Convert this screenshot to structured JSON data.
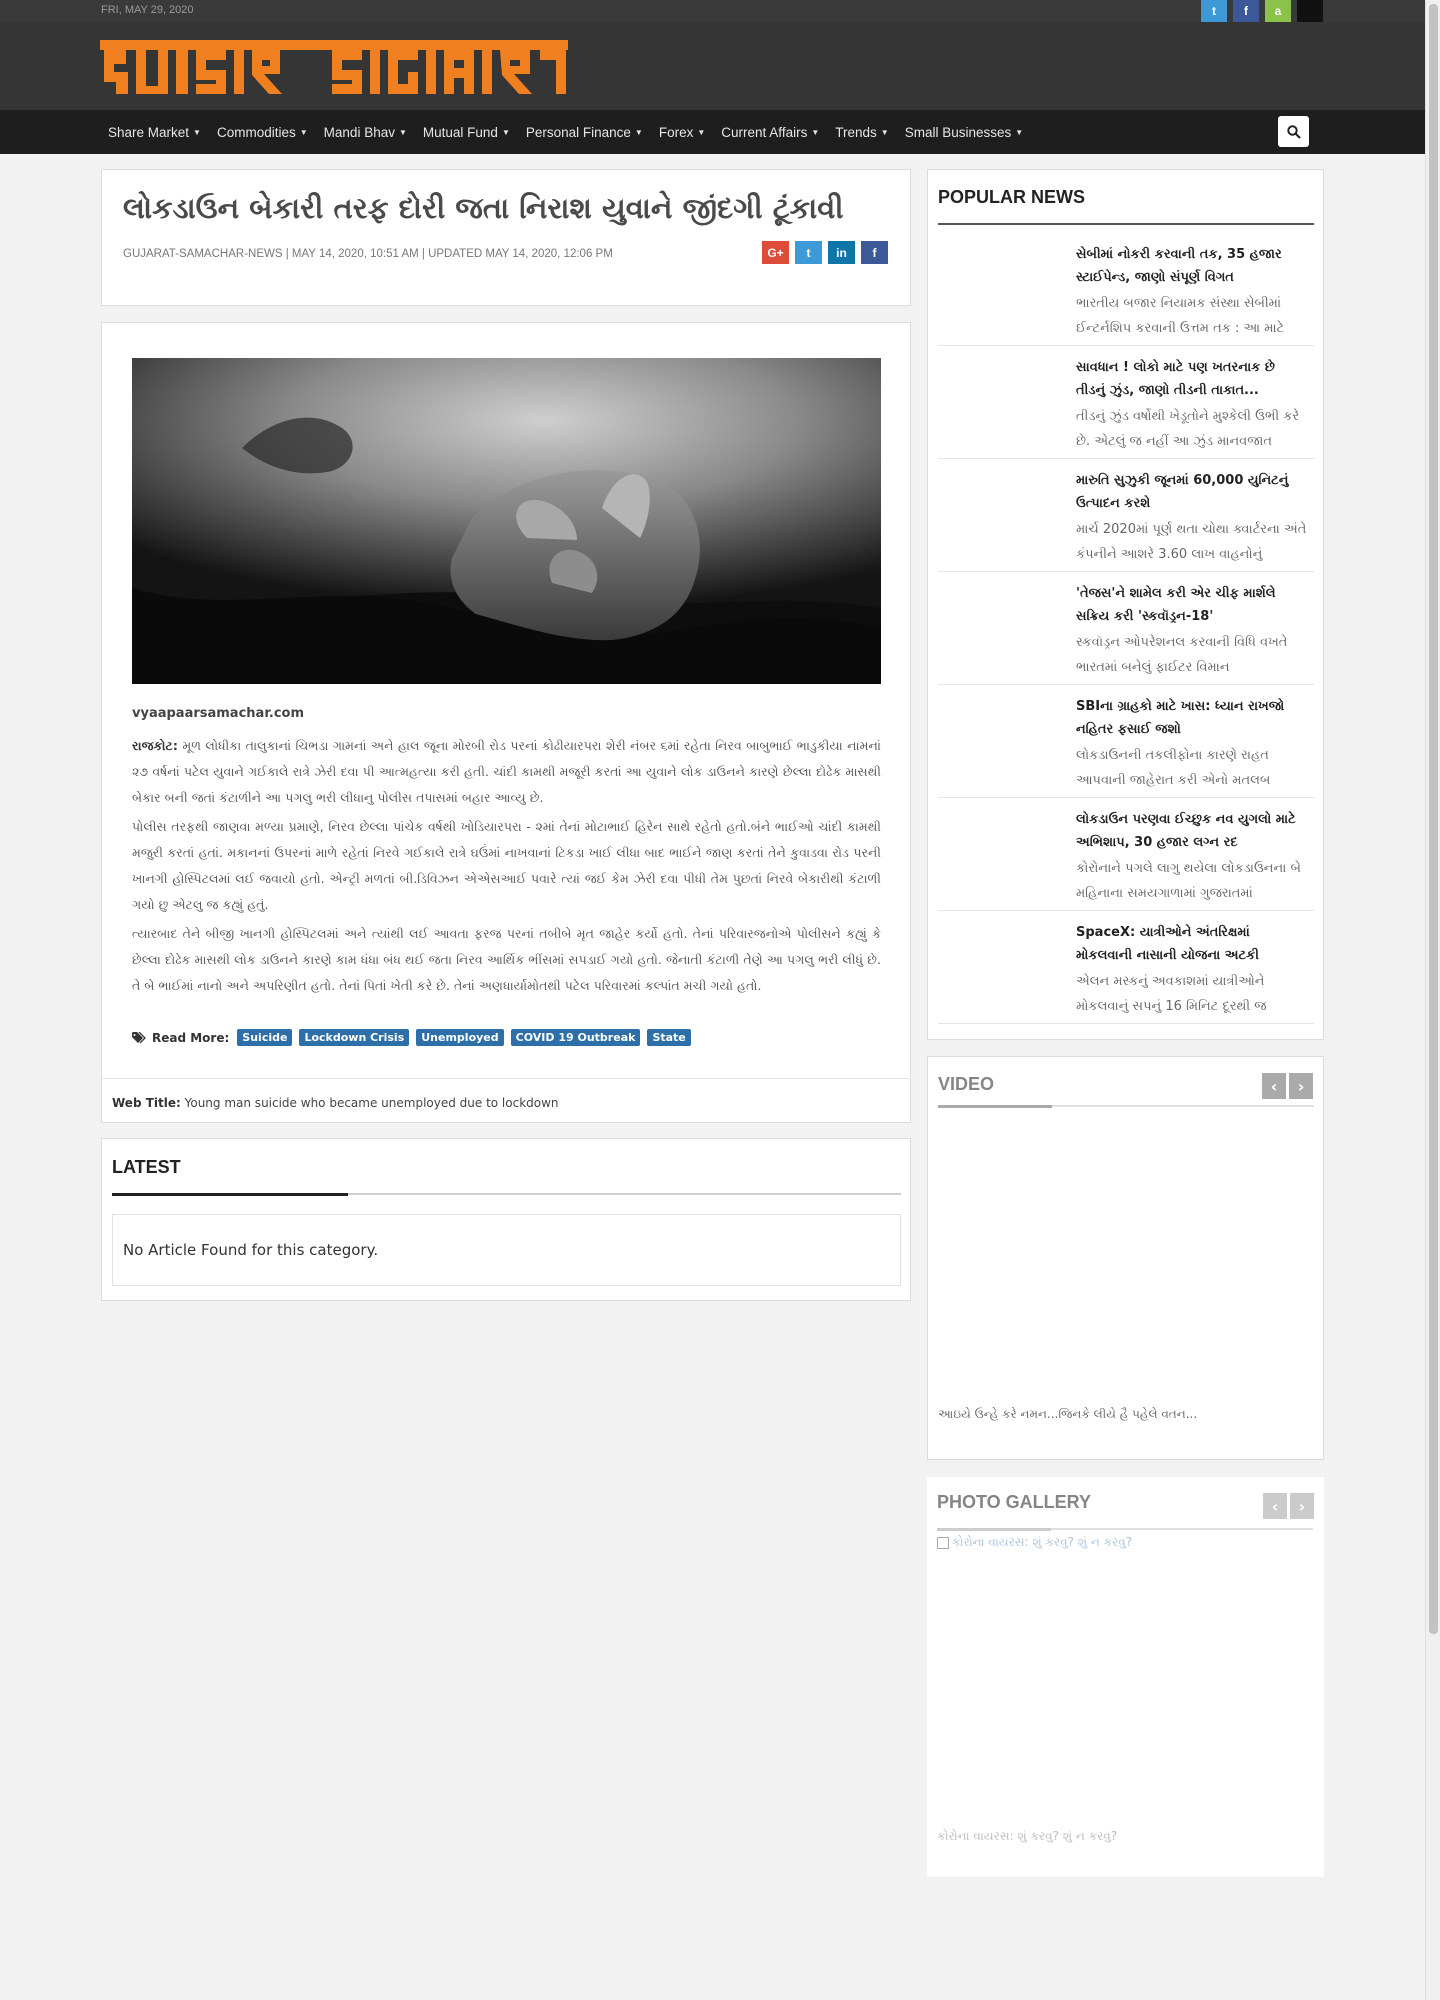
{
  "topbar": {
    "date": "FRI, MAY 29, 2020"
  },
  "social_top": [
    {
      "icon": "twitter-icon",
      "glyph": "t",
      "color": "#3d9ad6"
    },
    {
      "icon": "facebook-icon",
      "glyph": "f",
      "color": "#3b5998"
    },
    {
      "icon": "android-icon",
      "glyph": "a",
      "color": "#8bc34a"
    },
    {
      "icon": "apple-icon",
      "glyph": "",
      "color": "#111111"
    }
  ],
  "logo": {
    "text": "વ્યાપાર સમાચાર",
    "color": "#f07f20"
  },
  "nav": [
    {
      "label": "Share Market"
    },
    {
      "label": "Commodities"
    },
    {
      "label": "Mandi Bhav"
    },
    {
      "label": "Mutual Fund"
    },
    {
      "label": "Personal Finance"
    },
    {
      "label": "Forex"
    },
    {
      "label": "Current Affairs"
    },
    {
      "label": "Trends"
    },
    {
      "label": "Small Businesses"
    }
  ],
  "article": {
    "headline": "લોકડાઉન બેકારી તરફ દોરી જતા નિરાશ યુવાને જીંદગી ટૂંકાવી",
    "meta": "GUJARAT-SAMACHAR-NEWS | MAY 14, 2020, 10:51 AM | UPDATED MAY 14, 2020, 12:06 PM",
    "share": [
      {
        "icon": "google-plus-icon",
        "glyph": "G+",
        "color": "#dd4b39"
      },
      {
        "icon": "twitter-icon",
        "glyph": "t",
        "color": "#3d9ad6"
      },
      {
        "icon": "linkedin-icon",
        "glyph": "in",
        "color": "#0e76a8"
      },
      {
        "icon": "facebook-icon",
        "glyph": "f",
        "color": "#3b5998"
      }
    ],
    "source": "vyaapaarsamachar.com",
    "para1_lead": "રાજકોટ:",
    "para1": " મૂળ લોધીકા તાલુકાનાં ચિભડા ગામનાં અને હાલ જૂના મોરબી રોડ પરનાં કોઢીયારપરા શેરી નંબર ૬માં રહેતા નિરવ બાબુભાઈ ભાડુકીયા નામનાં ૨૭ વર્ષનાં પટેલ યુવાને ગઈકાલે રાત્રે ઝેરી દવા પી આત્મહત્યા કરી હતી. ચાંદી કામથી મજૂરી કરતાં આ યુવાને લોક ડાઉનને કારણે છેલ્લા દોઢેક માસથી બેકાર બની જતાં કંટાળીને આ પગલુ ભરી લીધાનુ પોલીસ તપાસમાં બહાર આવ્યુ છે.",
    "para2": "પોલીસ તરફથી જાણવા મળ્યા પ્રમાણે, નિરવ છેલ્લા પાંચેક વર્ષથી ખોડિયારપરા - ૨માં તેનાં મોટાભાઈ હિરેન સાથે રહેતો હતો.બંને ભાઈઓ ચાંદી કામથી મજુરી કરતાં હતાં. મકાનનાં ઉપરનાં માળે રહેતાં નિરવે ગઈકાલે રાત્રે ઘઉંમાં નાખવાનાં ટિકડા ખાઈ લીધા બાદ ભાઈને જાણ કરતાં તેને કુવાડવા રોડ પરની ખાનગી હોસ્પિટલમાં લઈ જવાયો હતો. એન્ટ્રી મળતાં બી.ડિવિઝન એએસઆઈ પવારે ત્યાં જઈ કેમ ઝેરી દવા પીધી તેમ પુછતાં નિરવે બેકારીથી કંટાળી ગયો છુ એટલુ જ કહ્યું હતું.",
    "para3": "ત્યારબાદ તેને  બીજી ખાનગી હોસ્પિટલમાં અને ત્યાંથી લઈ આવતા ફરજ પરનાં તબીબે મૃત જાહેર કર્યો હતો. તેનાં પરિવારજનોએ પોલીસને કહ્યું કે છેલ્લા દોઢેક માસથી લોક ડાઉનને કારણે કામ ધંધા બંધ થઈ જતા નિરવ આર્થિક ભીંસમાં સપડાઈ ગયો હતો. જેનાતી કંટાળી તેણે આ પગલુ ભરી લીધું છે. તે બે ભાઈમાં નાનો અને અપરિણીત હતો. તેનાં પિતાં ખેતી કરે છે. તેનાં અણધાર્યામોતથી પટેલ પરિવારમાં કલ્પાંત મચી ગયો હતો.",
    "read_more_label": "Read More:",
    "tags": [
      "Suicide",
      "Lockdown Crisis",
      "Unemployed",
      "COVID 19 Outbreak",
      "State"
    ],
    "web_title_label": "Web Title:",
    "web_title": " Young man suicide who became unemployed due to lockdown"
  },
  "latest": {
    "title": "LATEST",
    "empty_message": "No Article Found for this category."
  },
  "popular": {
    "title": "POPULAR NEWS",
    "items": [
      {
        "title": "સેબીમાં નોકરી કરવાની તક, 35 હજાર સ્ટાઈપેન્ડ, જાણો સંપૂર્ણ વિગત",
        "summary": "ભારતીય બજાર નિયામક સંસ્થા સેબીમાં ઈન્ટર્નશિપ કરવાની ઉત્તમ તક : આ માટે"
      },
      {
        "title": "સાવધાન ! લોકો માટે પણ ખતરનાક છે તીડનું ઝુંડ, જાણો તીડની તાકાત...",
        "summary": "તીડનું ઝુંડ વર્ષોથી ખેડૂતોને મુશ્કેલી ઉભી કરે છે. એટલું જ નહીં આ ઝુંડ માનવજાત"
      },
      {
        "title": "મારુતિ સુઝુકી જૂનમાં 60,000 યુનિટનું ઉત્પાદન કરશે",
        "summary": "માર્ચ 2020માં પૂર્ણ થતા ચોથા ક્વાર્ટરના અંતે કંપનીને આશરે 3.60 લાખ વાહનોનું"
      },
      {
        "title": "'તેજસ'ને શામેલ કરી એર ચીફ માર્શલે સક્રિય કરી 'સ્કવૉડ્રન-18'",
        "summary": "સ્કવૉડ્રન ઓપરેશનલ કરવાની વિધિ વખતે ભારતમાં બનેલું ફાઈટર વિમાન"
      },
      {
        "title": "SBIના ગ્રાહકો માટે ખાસ: ધ્યાન રાખજો નહિતર ફસાઈ જશો",
        "summary": "લોકડાઉનની તકલીફોના કારણે રાહત આપવાની જાહેરાત કરી એનો મતલબ"
      },
      {
        "title": "લોકડાઉન પરણવા ઈચ્છુક નવ યુગલો માટે અભિશાપ, 30 હજાર લગ્ન રદ",
        "summary": "કોરોનાને પગલે લાગુ થયેલા લોકડાઉનના બે મહિનાના સમયગાળામાં ગુજરાતમાં"
      },
      {
        "title": "SpaceX: યાત્રીઓને અંતરિક્ષમાં મોકલવાની નાસાની યોજના અટકી",
        "summary": "એલન મસ્કનું અવકાશમાં યાત્રીઓને મોકલવાનું સપનું 16 મિનિટ દૂરથી જ"
      }
    ]
  },
  "video": {
    "title": "VIDEO",
    "caption": "આઇયે ઉન્હે કરે નમન...જિનકે લીયે હૈ પહેલે વતન..."
  },
  "gallery": {
    "title": "PHOTO GALLERY",
    "img_alt": "કોરોના વાયરસ: શું કરવુ? શું ન કરવુ?",
    "caption": "કોરોના વાયરસ: શું કરવુ? શું ન કરવુ?"
  }
}
